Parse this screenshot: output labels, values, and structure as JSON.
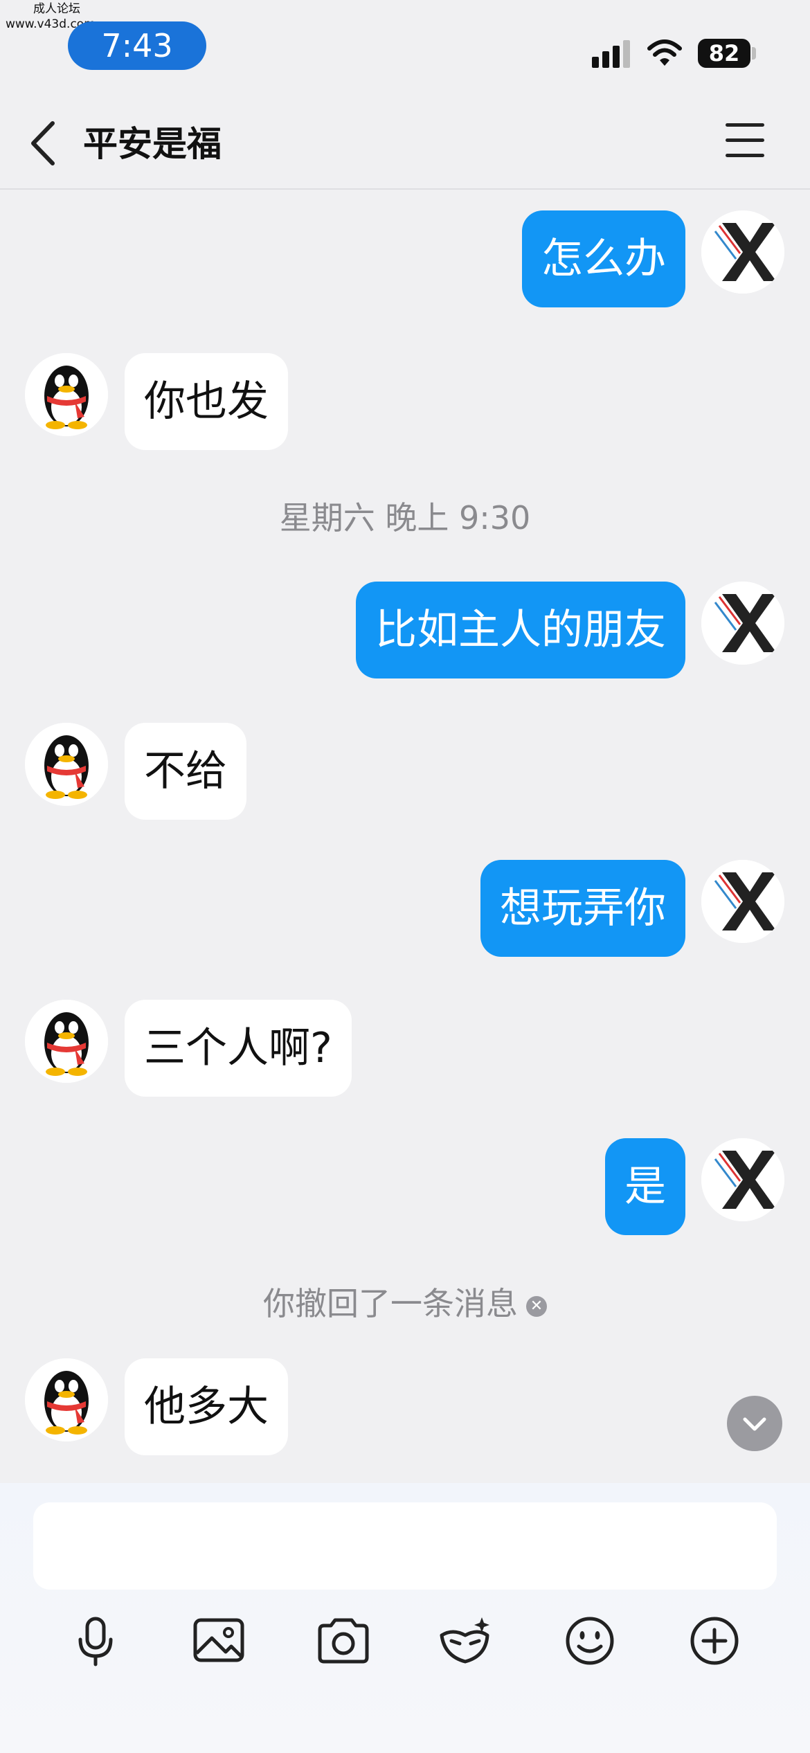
{
  "watermark": {
    "line1": "成人论坛",
    "line2": "www.v43d.com"
  },
  "status_bar": {
    "time": "7:43",
    "battery": "82"
  },
  "header": {
    "title": "平安是福"
  },
  "messages": [
    {
      "side": "out",
      "text": "怎么办"
    },
    {
      "side": "in",
      "text": "你也发"
    },
    {
      "type": "time",
      "text": "星期六 晚上 9:30"
    },
    {
      "side": "out",
      "text": "比如主人的朋友"
    },
    {
      "side": "in",
      "text": "不给"
    },
    {
      "side": "out",
      "text": "想玩弄你"
    },
    {
      "side": "in",
      "text": "三个人啊?"
    },
    {
      "side": "out",
      "text": "是"
    },
    {
      "type": "recall",
      "text": "你撤回了一条消息"
    },
    {
      "side": "in",
      "text": "他多大"
    }
  ],
  "toolbar": {
    "icons": [
      "mic-icon",
      "image-icon",
      "camera-icon",
      "sticker-icon",
      "emoji-icon",
      "plus-icon"
    ]
  },
  "colors": {
    "accent": "#1296f5",
    "time_pill": "#1a73d9",
    "background": "#f0f0f2"
  }
}
